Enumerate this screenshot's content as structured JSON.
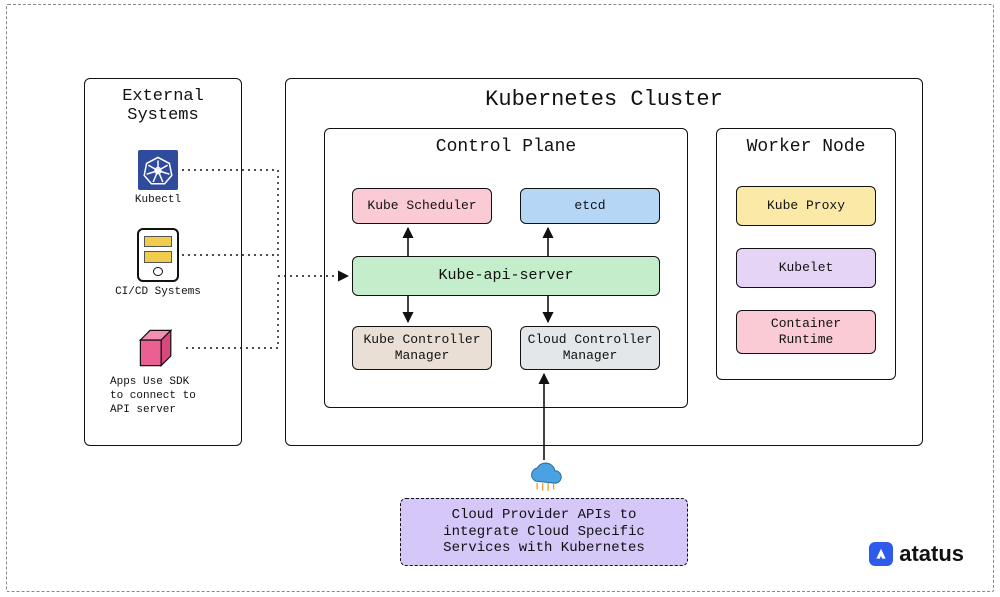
{
  "external": {
    "title": "External Systems",
    "kubectl_label": "Kubectl",
    "cicd_label": "CI/CD Systems",
    "sdk_label": "Apps Use SDK\nto connect to\nAPI server"
  },
  "cluster": {
    "title": "Kubernetes Cluster",
    "control_plane": {
      "title": "Control Plane",
      "scheduler": "Kube Scheduler",
      "etcd": "etcd",
      "apiserver": "Kube-api-server",
      "kcm": "Kube Controller\nManager",
      "ccm": "Cloud Controller\nManager"
    },
    "worker": {
      "title": "Worker Node",
      "kubeproxy": "Kube Proxy",
      "kubelet": "Kubelet",
      "runtime": "Container\nRuntime"
    }
  },
  "cloud_provider": "Cloud Provider APIs to\nintegrate Cloud Specific\nServices with Kubernetes",
  "brand": "atatus",
  "colors": {
    "pink": "#facbd4",
    "blue": "#b5d6f5",
    "green": "#c4edcb",
    "tan": "#eadfd4",
    "gray": "#e3e7ea",
    "yellow": "#fbe9a8",
    "lilac": "#e6d4f7",
    "cp_purple": "#d5c7f7",
    "kubectl_bg": "#304a9c",
    "sdk_pink": "#ec5f92",
    "cloud_blue": "#4aa3e0",
    "logo_blue": "#2f5bea"
  }
}
